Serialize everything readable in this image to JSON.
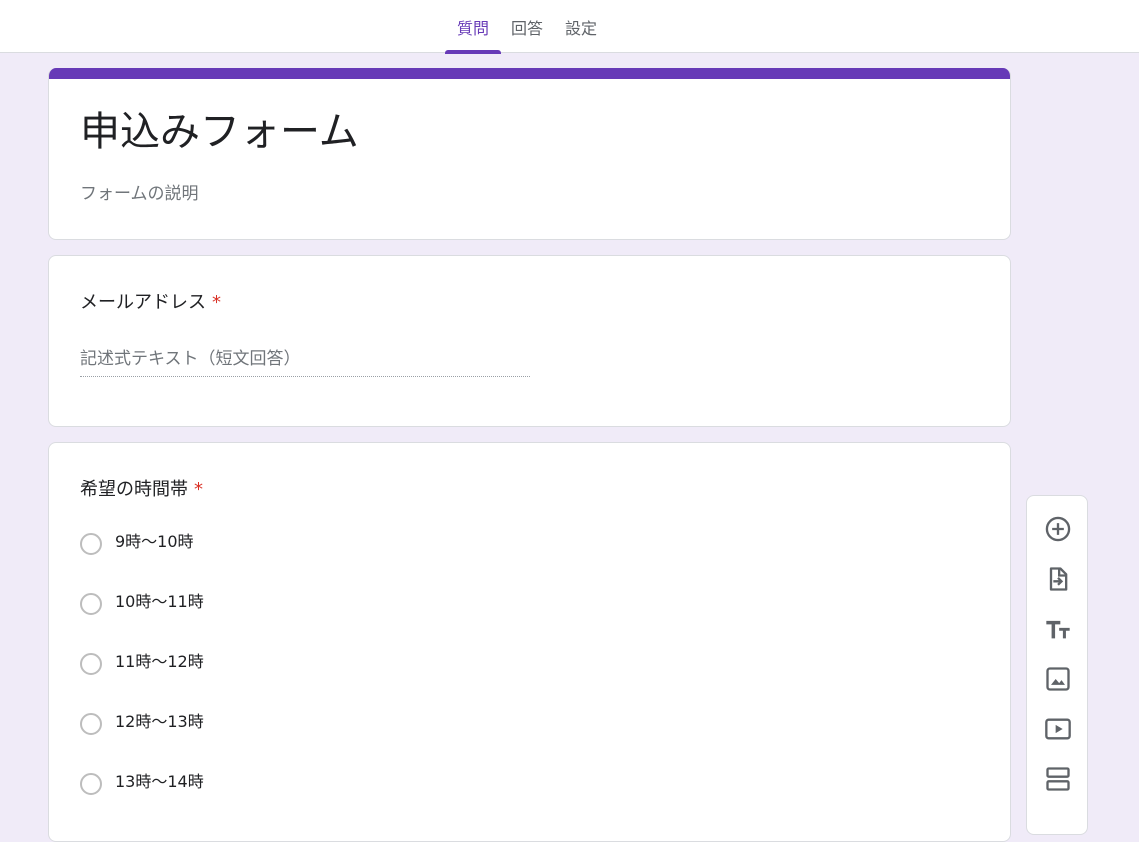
{
  "tabs": [
    {
      "label": "質問",
      "active": true
    },
    {
      "label": "回答",
      "active": false
    },
    {
      "label": "設定",
      "active": false
    }
  ],
  "form": {
    "title": "申込みフォーム",
    "description_placeholder": "フォームの説明",
    "accent_color": "#673ab7"
  },
  "questions": [
    {
      "title": "メールアドレス",
      "required_mark": "*",
      "type": "short_answer",
      "placeholder": "記述式テキスト（短文回答）"
    },
    {
      "title": "希望の時間帯",
      "required_mark": "*",
      "type": "multiple_choice",
      "options": [
        "9時～10時",
        "10時～11時",
        "11時～12時",
        "12時～13時",
        "13時～14時"
      ]
    }
  ],
  "toolbar": {
    "icons": [
      "add-question-icon",
      "import-questions-icon",
      "add-title-icon",
      "add-image-icon",
      "add-video-icon",
      "add-section-icon"
    ]
  }
}
